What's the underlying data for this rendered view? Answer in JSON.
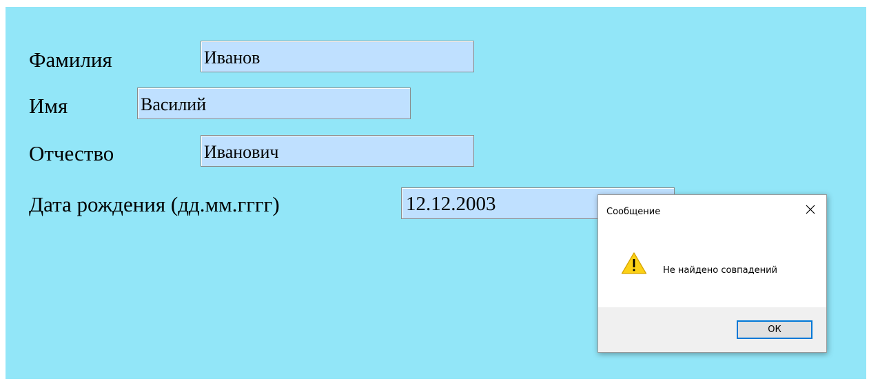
{
  "form": {
    "background": "#92e6f8",
    "field_background": "#bfe0ff",
    "surname": {
      "label": "Фамилия",
      "value": "Иванов"
    },
    "name": {
      "label": "Имя",
      "value": "Василий"
    },
    "patronymic": {
      "label": "Отчество",
      "value": "Иванович"
    },
    "birthdate": {
      "label": "Дата рождения (дд.мм.гггг)",
      "value": "12.12.2003"
    }
  },
  "dialog": {
    "title": "Сообщение",
    "close_icon": "close-icon",
    "icon": "warning-icon",
    "message": "Не найдено совпадений",
    "ok_label": "ОК",
    "accent": "#0078d7"
  }
}
